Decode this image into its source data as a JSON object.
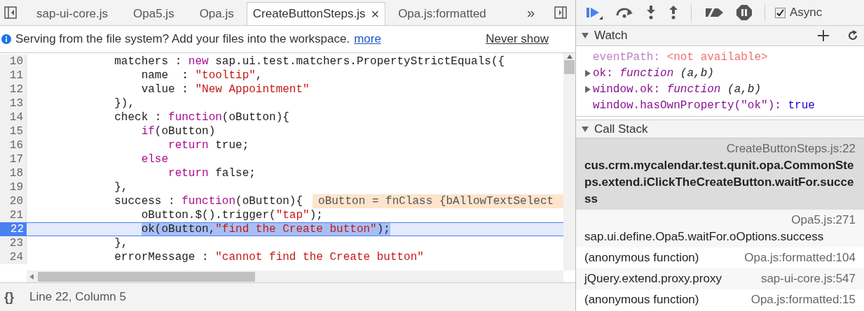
{
  "tabs": [
    {
      "label": "sap-ui-core.js",
      "selected": false
    },
    {
      "label": "Opa5.js",
      "selected": false
    },
    {
      "label": "Opa.js",
      "selected": false
    },
    {
      "label": "CreateButtonSteps.js",
      "selected": true,
      "close": "×"
    },
    {
      "label": "Opa.js:formatted",
      "selected": false
    }
  ],
  "tabs_overflow": "»",
  "infobar": {
    "message": "Serving from the file system? Add your files into the workspace.",
    "link": "more",
    "dismiss": "Never show"
  },
  "code_lines": [
    {
      "number": "10",
      "current": false,
      "tokens": [
        {
          "kind": "plain",
          "text": "            matchers : "
        },
        {
          "kind": "keyword",
          "text": "new"
        },
        {
          "kind": "plain",
          "text": " sap.ui.test.matchers.PropertyStrictEquals({"
        }
      ]
    },
    {
      "number": "11",
      "current": false,
      "tokens": [
        {
          "kind": "plain",
          "text": "                name  : "
        },
        {
          "kind": "string",
          "text": "\"tooltip\""
        },
        {
          "kind": "plain",
          "text": ","
        }
      ]
    },
    {
      "number": "12",
      "current": false,
      "tokens": [
        {
          "kind": "plain",
          "text": "                value : "
        },
        {
          "kind": "string",
          "text": "\"New Appointment\""
        }
      ]
    },
    {
      "number": "13",
      "current": false,
      "tokens": [
        {
          "kind": "plain",
          "text": "            }),"
        }
      ]
    },
    {
      "number": "14",
      "current": false,
      "tokens": [
        {
          "kind": "plain",
          "text": "            check : "
        },
        {
          "kind": "keyword",
          "text": "function"
        },
        {
          "kind": "plain",
          "text": "(oButton){"
        }
      ]
    },
    {
      "number": "15",
      "current": false,
      "tokens": [
        {
          "kind": "keyword",
          "text": "                if"
        },
        {
          "kind": "plain",
          "text": "(oButton)"
        }
      ]
    },
    {
      "number": "16",
      "current": false,
      "tokens": [
        {
          "kind": "keyword",
          "text": "                    return"
        },
        {
          "kind": "plain",
          "text": " true;"
        }
      ]
    },
    {
      "number": "17",
      "current": false,
      "tokens": [
        {
          "kind": "keyword",
          "text": "                else"
        }
      ]
    },
    {
      "number": "18",
      "current": false,
      "tokens": [
        {
          "kind": "keyword",
          "text": "                    return"
        },
        {
          "kind": "plain",
          "text": " false;"
        }
      ]
    },
    {
      "number": "19",
      "current": false,
      "tokens": [
        {
          "kind": "plain",
          "text": "            },"
        }
      ]
    },
    {
      "number": "20",
      "current": false,
      "tokens": [
        {
          "kind": "plain",
          "text": "            success : "
        },
        {
          "kind": "keyword",
          "text": "function"
        },
        {
          "kind": "plain",
          "text": "(oButton){"
        }
      ],
      "inline_value": "oButton = fnClass {bAllowTextSelect"
    },
    {
      "number": "21",
      "current": false,
      "tokens": [
        {
          "kind": "plain",
          "text": "                oButton.$().trigger("
        },
        {
          "kind": "string",
          "text": "\"tap\""
        },
        {
          "kind": "plain",
          "text": ");"
        }
      ]
    },
    {
      "number": "22",
      "current": true,
      "tokens": [
        {
          "kind": "plain_lead",
          "text": "                ok(oButton,"
        },
        {
          "kind": "selected_string",
          "text": "\"find the Create button\""
        },
        {
          "kind": "selected",
          "text": ");"
        }
      ]
    },
    {
      "number": "23",
      "current": false,
      "tokens": [
        {
          "kind": "plain",
          "text": "            },"
        }
      ]
    },
    {
      "number": "24",
      "current": false,
      "tokens": [
        {
          "kind": "plain",
          "text": "            errorMessage : "
        },
        {
          "kind": "string",
          "text": "\"cannot find the Create button\""
        }
      ]
    }
  ],
  "status_bar": {
    "format_icon": "{}",
    "position": "Line 22, Column 5"
  },
  "async": {
    "label": "Async",
    "checked": true
  },
  "watch": {
    "title": "Watch",
    "expanded": true,
    "items": [
      {
        "name": "eventPath:",
        "kind": "error",
        "value": "<not available>",
        "expandable": false
      },
      {
        "name": "ok:",
        "kind": "function",
        "value": "function",
        "args": "(a,b)",
        "expandable": true
      },
      {
        "name": "window.ok:",
        "kind": "function",
        "value": "function",
        "args": "(a,b)",
        "expandable": true
      },
      {
        "name": "window.hasOwnProperty(\"ok\"):",
        "kind": "boolean",
        "value": "true",
        "expandable": false
      }
    ]
  },
  "call_stack": {
    "title": "Call Stack",
    "expanded": true,
    "items": [
      {
        "function": "cus.crm.mycalendar.test.qunit.opa.CommonSteps.extend.iClickTheCreateButton.waitFor.success",
        "location": "CreateButtonSteps.js:22",
        "selected": true,
        "kind": "stacked"
      },
      {
        "function": "sap.ui.define.Opa5.waitFor.oOptions.success",
        "location": "Opa5.js:271",
        "selected": false,
        "kind": "stacked"
      },
      {
        "function": "(anonymous function)",
        "location": "Opa.js:formatted:104",
        "selected": false,
        "kind": "inline"
      },
      {
        "function": "jQuery.extend.proxy.proxy",
        "location": "sap-ui-core.js:547",
        "selected": false,
        "kind": "inline"
      },
      {
        "function": "(anonymous function)",
        "location": "Opa.js:formatted:15",
        "selected": false,
        "kind": "inline"
      }
    ]
  }
}
